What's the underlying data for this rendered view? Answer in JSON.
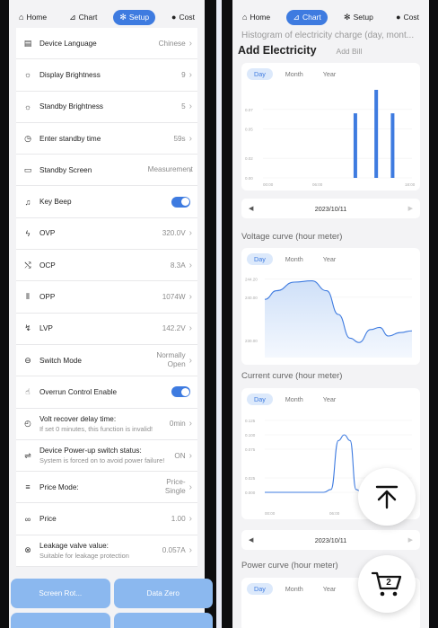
{
  "left": {
    "nav": [
      {
        "label": "Home",
        "icon": "home-icon",
        "active": false
      },
      {
        "label": "Chart",
        "icon": "chart-icon",
        "active": false
      },
      {
        "label": "Setup",
        "icon": "gear-icon",
        "active": true
      },
      {
        "label": "Cost",
        "icon": "info-icon",
        "active": false
      }
    ],
    "settings": [
      {
        "label": "Device Language",
        "value": "Chinese",
        "icon": "document-icon"
      },
      {
        "label": "Display Brightness",
        "value": "9",
        "icon": "sun-icon"
      },
      {
        "label": "Standby Brightness",
        "value": "5",
        "icon": "sun-outline-icon"
      },
      {
        "label": "Enter standby time",
        "value": "59s",
        "icon": "clock-icon"
      },
      {
        "label": "Standby Screen",
        "value": "Measurement",
        "icon": "monitor-icon"
      },
      {
        "label": "Key Beep",
        "icon": "bell-icon",
        "toggle": true
      },
      {
        "label": "OVP",
        "value": "320.0V",
        "icon": "bolt-icon"
      },
      {
        "label": "OCP",
        "value": "8.3A",
        "icon": "shuffle-icon"
      },
      {
        "label": "OPP",
        "value": "1074W",
        "icon": "waveform-icon"
      },
      {
        "label": "LVP",
        "value": "142.2V",
        "icon": "low-voltage-icon"
      },
      {
        "label": "Switch Mode",
        "value": "Normally Open",
        "icon": "minus-circle-icon"
      },
      {
        "label": "Overrun Control Enable",
        "icon": "alert-hand-icon",
        "toggle": true
      },
      {
        "label": "Volt recover delay time:",
        "sub": "If set 0 minutes, this function is invalid!",
        "value": "0min",
        "icon": "stopwatch-icon"
      },
      {
        "label": "Device Power-up switch status:",
        "sub": "System is forced on to avoid power failure!",
        "value": "ON",
        "icon": "sliders-icon"
      },
      {
        "label": "Price Mode:",
        "value": "Price-Single",
        "icon": "menu-icon"
      },
      {
        "label": "Price",
        "value": "1.00",
        "icon": "link-icon"
      },
      {
        "label": "Leakage valve value:",
        "sub": "Suitable for leakage protection",
        "value": "0.057A",
        "icon": "shield-x-icon"
      }
    ],
    "buttons": [
      "Screen Rot...",
      "Data Zero"
    ]
  },
  "right": {
    "nav": [
      {
        "label": "Home",
        "icon": "home-icon",
        "active": false
      },
      {
        "label": "Chart",
        "icon": "chart-icon",
        "active": true
      },
      {
        "label": "Setup",
        "icon": "gear-icon",
        "active": false
      },
      {
        "label": "Cost",
        "icon": "info-icon",
        "active": false
      }
    ],
    "faded_title": "Histogram of electricity charge (day, mont...",
    "header_main": "Add Electricity",
    "header_sub": "Add Bill",
    "tabs": [
      "Day",
      "Month",
      "Year"
    ],
    "date": "2023/10/11",
    "voltage_title": "Voltage curve (hour meter)",
    "current_title": "Current curve (hour meter)",
    "power_title": "Power curve (hour meter)",
    "cart_count": "2",
    "accent": "#3e7be0"
  },
  "chart_data": [
    {
      "type": "bar",
      "title": "Histogram of electricity charge (day, mont...",
      "x_ticks": [
        "00:00",
        "06:00",
        "18:00"
      ],
      "y_ticks": [
        0.0,
        0.02,
        0.05,
        0.07
      ],
      "ylim": [
        0,
        0.09
      ],
      "bars": [
        {
          "x": 0.62,
          "value": 0.066
        },
        {
          "x": 0.76,
          "value": 0.09
        },
        {
          "x": 0.87,
          "value": 0.066
        }
      ]
    },
    {
      "type": "area",
      "title": "Voltage curve (hour meter)",
      "y_ticks": [
        230.0,
        240.0,
        244.2
      ],
      "ylim": [
        226,
        246
      ],
      "points": [
        [
          0.0,
          239.5
        ],
        [
          0.08,
          241.5
        ],
        [
          0.2,
          243.5
        ],
        [
          0.32,
          243.8
        ],
        [
          0.42,
          241.5
        ],
        [
          0.5,
          236
        ],
        [
          0.58,
          230.5
        ],
        [
          0.64,
          229.5
        ],
        [
          0.72,
          232.5
        ],
        [
          0.78,
          233
        ],
        [
          0.84,
          231
        ],
        [
          0.92,
          231.8
        ],
        [
          1.0,
          232.2
        ]
      ]
    },
    {
      "type": "line",
      "title": "Current curve (hour meter)",
      "x_ticks": [
        "00:00",
        "06:00"
      ],
      "y_ticks": [
        0.0,
        0.025,
        0.075,
        0.1,
        0.125
      ],
      "ylim": [
        -0.025,
        0.125
      ],
      "points": [
        [
          0.0,
          0.0
        ],
        [
          0.4,
          0.0
        ],
        [
          0.45,
          0.005
        ],
        [
          0.5,
          0.09
        ],
        [
          0.54,
          0.1
        ],
        [
          0.58,
          0.09
        ],
        [
          0.62,
          0.005
        ],
        [
          0.66,
          0.0
        ],
        [
          0.75,
          0.0
        ]
      ]
    }
  ]
}
